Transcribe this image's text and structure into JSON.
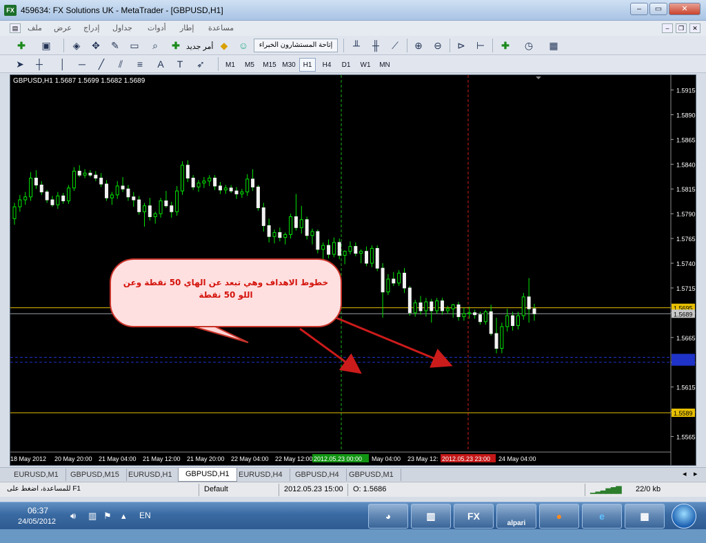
{
  "window": {
    "title": "459634: FX Solutions UK - MetaTrader - [GBPUSD,H1]",
    "app_icon": "FX"
  },
  "window_controls": [
    "–",
    "▭",
    "✕"
  ],
  "menu": {
    "items": [
      "ملف",
      "عرض",
      "إدراج",
      "جداول",
      "أدوات",
      "إطار",
      "مساعدة"
    ]
  },
  "toolbar": {
    "new_order_label": "أمر جديد",
    "experts_label": "إتاحة المستشارون الخبراء",
    "timeframes": [
      "M1",
      "M5",
      "M15",
      "M30",
      "H1",
      "H4",
      "D1",
      "W1",
      "MN"
    ],
    "active_timeframe": "H1"
  },
  "chart_data": {
    "type": "candlestick",
    "symbol_label": "GBPUSD,H1  1.5687 1.5699 1.5682 1.5689",
    "ylim": [
      1.555,
      1.593
    ],
    "y_ticks": [
      "1.5915",
      "1.5890",
      "1.5865",
      "1.5840",
      "1.5815",
      "1.5790",
      "1.5765",
      "1.5740",
      "1.5715",
      "1.5690",
      "1.5665",
      "1.5640",
      "1.5615",
      "1.5590",
      "1.5565"
    ],
    "x_ticks": [
      "18 May 2012",
      "20 May 20:00",
      "21 May 04:00",
      "21 May 12:00",
      "21 May 20:00",
      "22 May 04:00",
      "22 May 12:00",
      "2012.05.23 00:00",
      "May 04:00",
      "23 May 12:",
      "2012.05.23 23:00",
      "24 May 04:00"
    ],
    "price_labels": [
      {
        "value": "1.5695",
        "color": "#e8c000"
      },
      {
        "value": "1.5689",
        "color": "#c8c8c8"
      },
      {
        "value": "1.5589",
        "color": "#e8c000"
      }
    ],
    "horizontal_lines": [
      {
        "value": 1.5695,
        "color": "#e8c000",
        "style": "solid"
      },
      {
        "value": 1.5689,
        "color": "#9aa0a6",
        "style": "solid"
      },
      {
        "value": 1.5645,
        "color": "#1f33c8",
        "style": "dashed"
      },
      {
        "value": 1.564,
        "color": "#1f33c8",
        "style": "dashed"
      },
      {
        "value": 1.5589,
        "color": "#e8c000",
        "style": "solid"
      }
    ],
    "vertical_lines": [
      {
        "label": "2012.05.23 00:00",
        "color": "#1bb31b"
      },
      {
        "label": "2012.05.23 23:00",
        "color": "#d11c1c"
      }
    ],
    "candles": [
      [
        1.5785,
        1.5801,
        1.5779,
        1.5797
      ],
      [
        1.5797,
        1.5809,
        1.5792,
        1.5804
      ],
      [
        1.5804,
        1.5812,
        1.5799,
        1.5807
      ],
      [
        1.5807,
        1.5832,
        1.5803,
        1.5826
      ],
      [
        1.5826,
        1.5834,
        1.5815,
        1.5819
      ],
      [
        1.5819,
        1.5823,
        1.5809,
        1.5812
      ],
      [
        1.5812,
        1.5814,
        1.5801,
        1.5804
      ],
      [
        1.5804,
        1.5808,
        1.5797,
        1.5799
      ],
      [
        1.5799,
        1.5812,
        1.5795,
        1.5808
      ],
      [
        1.5808,
        1.5811,
        1.58,
        1.5803
      ],
      [
        1.5803,
        1.5819,
        1.58,
        1.5816
      ],
      [
        1.5816,
        1.5837,
        1.5813,
        1.5833
      ],
      [
        1.5833,
        1.5839,
        1.5827,
        1.5829
      ],
      [
        1.5829,
        1.5835,
        1.5826,
        1.5831
      ],
      [
        1.5831,
        1.5834,
        1.5827,
        1.5829
      ],
      [
        1.5829,
        1.5833,
        1.5823,
        1.5826
      ],
      [
        1.5826,
        1.5831,
        1.5817,
        1.582
      ],
      [
        1.582,
        1.5824,
        1.5803,
        1.5806
      ],
      [
        1.5806,
        1.5812,
        1.5799,
        1.5809
      ],
      [
        1.5809,
        1.5823,
        1.5805,
        1.5818
      ],
      [
        1.5818,
        1.5827,
        1.5812,
        1.5815
      ],
      [
        1.5815,
        1.5819,
        1.5803,
        1.5807
      ],
      [
        1.5807,
        1.5812,
        1.5797,
        1.5804
      ],
      [
        1.5804,
        1.5808,
        1.5789,
        1.5792
      ],
      [
        1.5792,
        1.5801,
        1.5777,
        1.5798
      ],
      [
        1.5798,
        1.5806,
        1.5783,
        1.5787
      ],
      [
        1.5787,
        1.5792,
        1.578,
        1.579
      ],
      [
        1.579,
        1.5806,
        1.5786,
        1.5803
      ],
      [
        1.5803,
        1.5813,
        1.5796,
        1.5798
      ],
      [
        1.5798,
        1.5802,
        1.5786,
        1.5792
      ],
      [
        1.5792,
        1.5818,
        1.5788,
        1.5813
      ],
      [
        1.5813,
        1.5843,
        1.5809,
        1.5839
      ],
      [
        1.5839,
        1.5844,
        1.5822,
        1.5826
      ],
      [
        1.5826,
        1.5829,
        1.5814,
        1.5817
      ],
      [
        1.5817,
        1.5824,
        1.5812,
        1.5821
      ],
      [
        1.5821,
        1.5827,
        1.5816,
        1.5823
      ],
      [
        1.5823,
        1.5829,
        1.5818,
        1.5826
      ],
      [
        1.5826,
        1.5829,
        1.5814,
        1.5818
      ],
      [
        1.5818,
        1.5822,
        1.581,
        1.5814
      ],
      [
        1.5814,
        1.5819,
        1.581,
        1.5816
      ],
      [
        1.5816,
        1.5819,
        1.5811,
        1.5813
      ],
      [
        1.5813,
        1.5817,
        1.5805,
        1.581
      ],
      [
        1.581,
        1.5815,
        1.5806,
        1.5812
      ],
      [
        1.5812,
        1.583,
        1.5808,
        1.5825
      ],
      [
        1.5825,
        1.5835,
        1.5813,
        1.5817
      ],
      [
        1.5817,
        1.5819,
        1.5793,
        1.5796
      ],
      [
        1.5796,
        1.5801,
        1.5772,
        1.5778
      ],
      [
        1.5778,
        1.5785,
        1.5761,
        1.5767
      ],
      [
        1.5767,
        1.5774,
        1.576,
        1.5771
      ],
      [
        1.5771,
        1.5776,
        1.5762,
        1.5766
      ],
      [
        1.5766,
        1.5771,
        1.5759,
        1.5769
      ],
      [
        1.5769,
        1.579,
        1.5765,
        1.5787
      ],
      [
        1.5787,
        1.581,
        1.5773,
        1.5776
      ],
      [
        1.5776,
        1.5798,
        1.577,
        1.5784
      ],
      [
        1.5784,
        1.5787,
        1.5764,
        1.5768
      ],
      [
        1.5768,
        1.5775,
        1.5759,
        1.5772
      ],
      [
        1.5772,
        1.5774,
        1.575,
        1.5754
      ],
      [
        1.5754,
        1.5761,
        1.5742,
        1.5758
      ],
      [
        1.5758,
        1.5764,
        1.5745,
        1.5749
      ],
      [
        1.5749,
        1.5766,
        1.5746,
        1.5761
      ],
      [
        1.5761,
        1.5765,
        1.5744,
        1.5748
      ],
      [
        1.5748,
        1.5753,
        1.5739,
        1.5752
      ],
      [
        1.5752,
        1.5762,
        1.5749,
        1.5757
      ],
      [
        1.5757,
        1.5761,
        1.5747,
        1.575
      ],
      [
        1.575,
        1.5754,
        1.574,
        1.5752
      ],
      [
        1.5752,
        1.5757,
        1.5737,
        1.574
      ],
      [
        1.574,
        1.5758,
        1.5736,
        1.5755
      ],
      [
        1.5755,
        1.5758,
        1.5732,
        1.5735
      ],
      [
        1.5735,
        1.574,
        1.5685,
        1.5711
      ],
      [
        1.5711,
        1.5729,
        1.5708,
        1.5724
      ],
      [
        1.5724,
        1.5731,
        1.5717,
        1.572
      ],
      [
        1.572,
        1.5733,
        1.5717,
        1.573
      ],
      [
        1.573,
        1.5735,
        1.571,
        1.5715
      ],
      [
        1.5715,
        1.5717,
        1.5687,
        1.569
      ],
      [
        1.569,
        1.5703,
        1.5686,
        1.57
      ],
      [
        1.57,
        1.5707,
        1.5688,
        1.5692
      ],
      [
        1.5692,
        1.5705,
        1.5686,
        1.5701
      ],
      [
        1.5701,
        1.5704,
        1.568,
        1.5692
      ],
      [
        1.5692,
        1.5705,
        1.5689,
        1.5702
      ],
      [
        1.5702,
        1.5705,
        1.5688,
        1.5692
      ],
      [
        1.5692,
        1.5697,
        1.5689,
        1.5694
      ],
      [
        1.5694,
        1.5699,
        1.5685,
        1.5698
      ],
      [
        1.5698,
        1.5701,
        1.5682,
        1.5686
      ],
      [
        1.5686,
        1.5695,
        1.5682,
        1.5689
      ],
      [
        1.5689,
        1.5696,
        1.5684,
        1.569
      ],
      [
        1.569,
        1.5693,
        1.5684,
        1.5688
      ],
      [
        1.5688,
        1.5691,
        1.5678,
        1.5681
      ],
      [
        1.5681,
        1.5693,
        1.5678,
        1.5691
      ],
      [
        1.5691,
        1.5698,
        1.5667,
        1.5669
      ],
      [
        1.5669,
        1.5685,
        1.5649,
        1.5654
      ],
      [
        1.5654,
        1.568,
        1.5649,
        1.5676
      ],
      [
        1.5676,
        1.5694,
        1.5671,
        1.5687
      ],
      [
        1.5687,
        1.5691,
        1.5672,
        1.5677
      ],
      [
        1.5677,
        1.5691,
        1.5673,
        1.5687
      ],
      [
        1.5687,
        1.571,
        1.5683,
        1.5706
      ],
      [
        1.5706,
        1.5725,
        1.568,
        1.5694
      ],
      [
        1.5694,
        1.5699,
        1.5682,
        1.5689
      ]
    ]
  },
  "callout": {
    "text": "خطوط الاهداف وهي تبعد عن الهاي 50 نقطة وعن اللو 50 نقطة"
  },
  "tabs": [
    "EURUSD,M1",
    "GBPUSD,M15",
    "EURUSD,H1",
    "GBPUSD,H1",
    "EURUSD,H4",
    "GBPUSD,H4",
    "GBPUSD,M1"
  ],
  "active_tab": "GBPUSD,H1",
  "status": {
    "help": "للمساعدة، اضغط على F1",
    "profile": "Default",
    "datetime": "2012.05.23 15:00",
    "open": "O: 1.5686",
    "traffic": "22/0 kb"
  },
  "taskbar": {
    "time": "06:37",
    "date": "24/05/2012",
    "lang": "EN",
    "fx_label": "FX",
    "alpari_label": "alpari"
  }
}
